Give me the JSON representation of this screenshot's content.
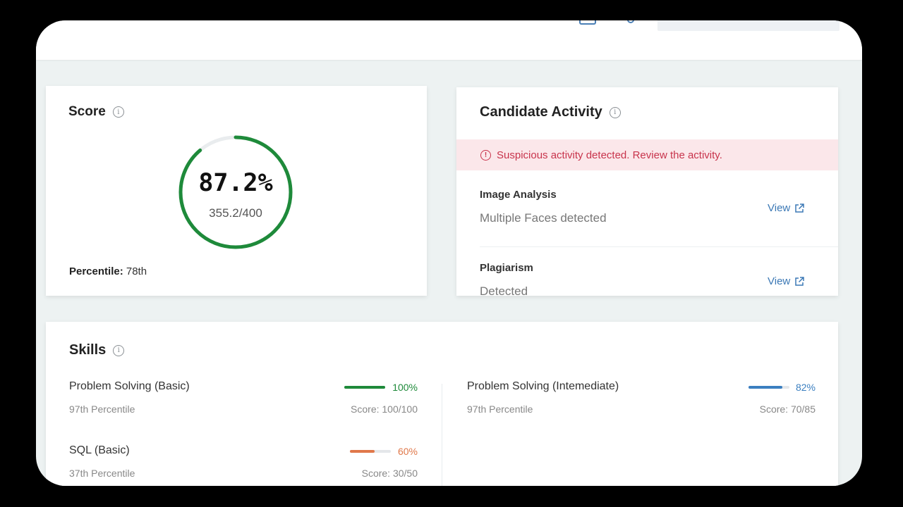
{
  "score": {
    "title": "Score",
    "value_label": "87.2%",
    "fraction_label": "355.2/400",
    "fraction": 0.888,
    "ring_color": "#1e8a3a",
    "percentile_label": "Percentile:",
    "percentile_value": "78th"
  },
  "activity": {
    "title": "Candidate Activity",
    "alert": "Suspicious activity detected. Review the activity.",
    "items": [
      {
        "label": "Image Analysis",
        "value": "Multiple Faces detected",
        "action": "View"
      },
      {
        "label": "Plagiarism",
        "value": "Detected",
        "action": "View"
      }
    ]
  },
  "skills": {
    "title": "Skills",
    "items": [
      {
        "name": "Problem Solving (Basic)",
        "pct_label": "100%",
        "fraction": 1.0,
        "color": "#1e8a3a",
        "percentile": "97th Percentile",
        "score": "Score: 100/100"
      },
      {
        "name": "Problem Solving (Intemediate)",
        "pct_label": "82%",
        "fraction": 0.82,
        "color": "#3b7fc0",
        "percentile": "97th Percentile",
        "score": "Score: 70/85"
      },
      {
        "name": "SQL (Basic)",
        "pct_label": "60%",
        "fraction": 0.6,
        "color": "#e0784a",
        "percentile": "37th Percentile",
        "score": "Score: 30/50"
      }
    ]
  }
}
